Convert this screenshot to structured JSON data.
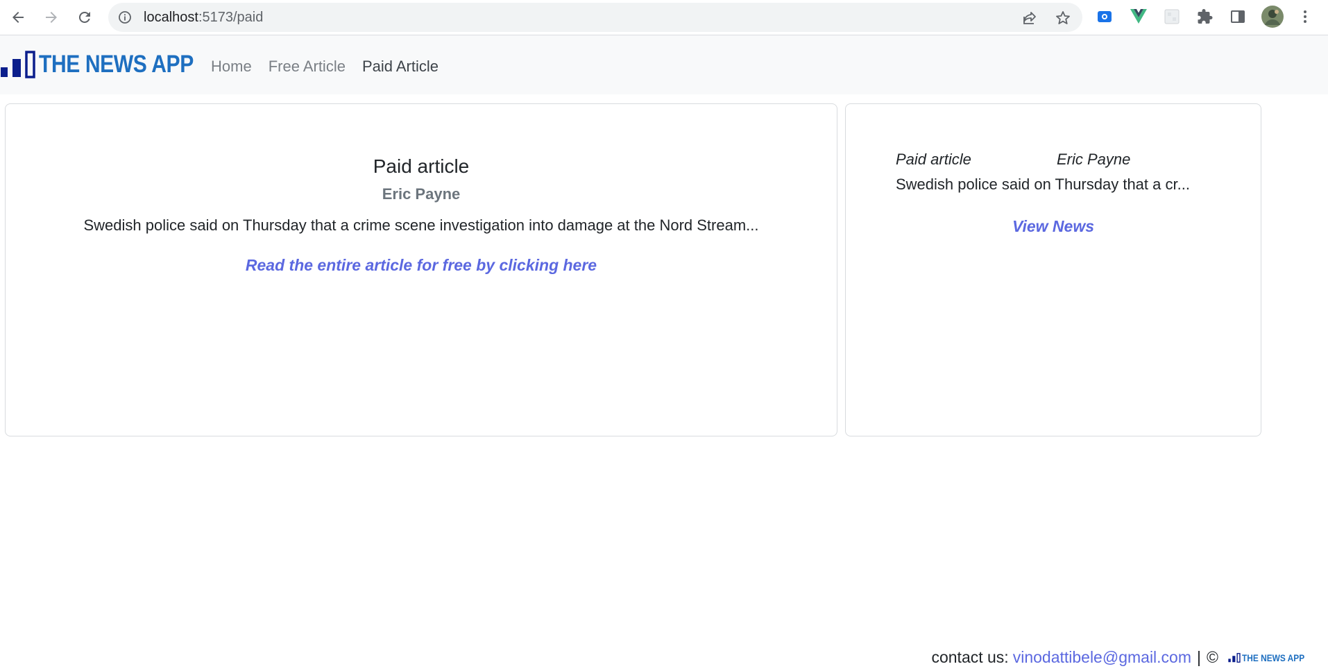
{
  "browser": {
    "url_host": "localhost",
    "url_path": ":5173/paid",
    "icons": [
      "back-arrow-icon",
      "forward-arrow-icon",
      "reload-icon",
      "site-info-icon",
      "share-icon",
      "bookmark-star-icon",
      "screen-capture-extension-icon",
      "vue-devtools-extension-icon",
      "blank-extension-icon",
      "extensions-puzzle-icon",
      "side-panel-icon",
      "profile-avatar-icon",
      "menu-kebab-icon"
    ]
  },
  "navbar": {
    "brand": "THE NEWS APP",
    "links": [
      {
        "label": "Home",
        "active": false
      },
      {
        "label": "Free Article",
        "active": false
      },
      {
        "label": "Paid Article",
        "active": true
      }
    ]
  },
  "main_card": {
    "title": "Paid article",
    "author": "Eric Payne",
    "excerpt": "Swedish police said on Thursday that a crime scene investigation into damage at the Nord Stream...",
    "link": "Read the entire article for free by clicking here"
  },
  "side_card": {
    "title": "Paid article",
    "author": "Eric Payne",
    "excerpt": "Swedish police said on Thursday that a cr...",
    "link": "View News"
  },
  "footer": {
    "contact_label": "contact us:",
    "email": "vinodattibele@gmail.com",
    "separator": "|",
    "copyright": "©",
    "brand": "THE NEWS APP"
  },
  "colors": {
    "brand_blue": "#1e6fc0",
    "logo_navy": "#0b1e8c",
    "link_purple": "#5b68e0",
    "navbar_bg": "#f8f9fa"
  }
}
